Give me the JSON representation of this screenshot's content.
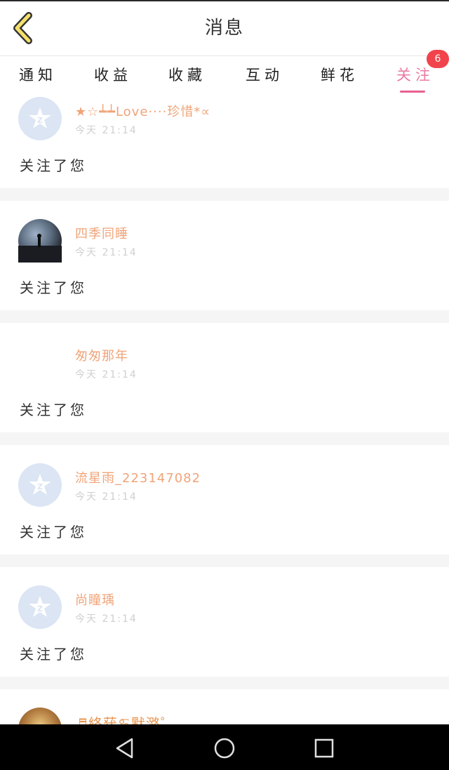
{
  "header": {
    "title": "消息"
  },
  "tabs": [
    {
      "label": "通知"
    },
    {
      "label": "收益"
    },
    {
      "label": "收藏"
    },
    {
      "label": "互动"
    },
    {
      "label": "鲜花"
    },
    {
      "label": "关注",
      "active": true,
      "badge": "6"
    }
  ],
  "items": [
    {
      "username": "★☆┷┷Love····珍惜*∝",
      "time": "今天 21:14",
      "action": "关注了您",
      "avatar": "default-avatar"
    },
    {
      "username": "四季同睡",
      "time": "今天 21:14",
      "action": "关注了您",
      "avatar": "photo-avatar"
    },
    {
      "username": "匆匆那年",
      "time": "今天 21:14",
      "action": "关注了您",
      "avatar": "none"
    },
    {
      "username": "流星雨_223147082",
      "time": "今天 21:14",
      "action": "关注了您",
      "avatar": "default-avatar"
    },
    {
      "username": "尚瞳瑀",
      "time": "今天 21:14",
      "action": "关注了您",
      "avatar": "default-avatar"
    },
    {
      "username": "♬終莸♋默潞゜",
      "time": "",
      "action": "",
      "avatar": "photo-avatar"
    }
  ],
  "colors": {
    "accent": "#ea5f90",
    "username": "#f0a479",
    "badge": "#f1434b",
    "back_icon": "#f4e06b"
  },
  "navbar": {
    "icons": [
      "back-triangle-icon",
      "home-circle-icon",
      "recents-square-icon"
    ]
  }
}
